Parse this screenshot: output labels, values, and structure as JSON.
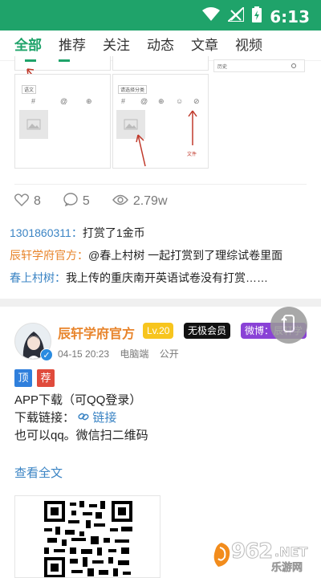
{
  "status": {
    "time": "6:13"
  },
  "tabs": [
    {
      "label": "全部",
      "active": true
    },
    {
      "label": "推荐",
      "active": false
    },
    {
      "label": "关注",
      "active": false
    },
    {
      "label": "动态",
      "active": false
    },
    {
      "label": "文章",
      "active": false
    },
    {
      "label": "视频",
      "active": false
    }
  ],
  "embedded": {
    "history_label": "历史",
    "card1_label": "语文",
    "card2_label": "请选择分类",
    "file_label": "文件"
  },
  "stats": {
    "likes": "8",
    "comments": "5",
    "views": "2.79w"
  },
  "comments": [
    {
      "user": "1301860311：",
      "text": "打赏了1金币"
    },
    {
      "user": "辰轩学府官方：",
      "text": "@春上村树 一起打赏到了理综试卷里面"
    },
    {
      "user": "春上村树：",
      "text": "我上传的重庆南开英语试卷没有打赏……"
    }
  ],
  "post": {
    "author": "辰轩学府官方",
    "level": "Lv.20",
    "vip": "无极会员",
    "weibo": "微博：辰轩学",
    "date": "04-15 20:23",
    "device": "电脑端",
    "visibility": "公开",
    "tag_top": "顶",
    "tag_rec": "荐",
    "line1": "APP下载（可QQ登录）",
    "line2_prefix": "下载链接：",
    "link_label": "链接",
    "line3": "也可以qq。微信扫二维码",
    "more": "查看全文"
  },
  "watermark": {
    "text1": "962",
    "text2": ".NET",
    "text3": "乐游网"
  }
}
